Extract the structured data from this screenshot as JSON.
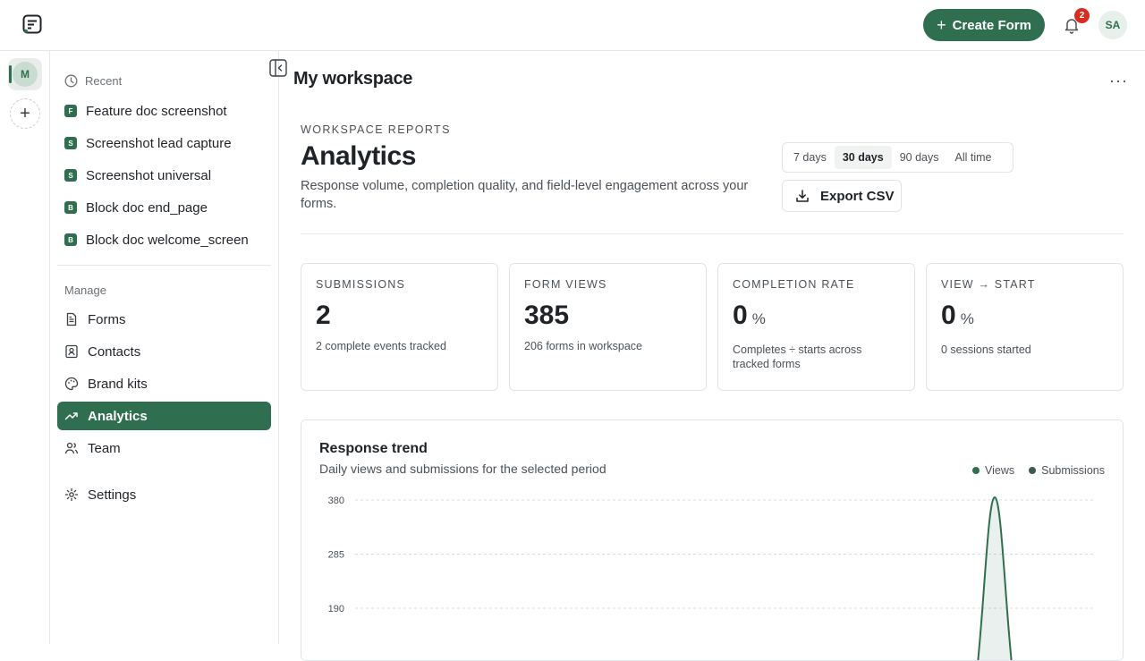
{
  "topbar": {
    "create_label": "Create Form",
    "notifications": "2",
    "user_initials": "SA"
  },
  "rail": {
    "workspace_initial": "M",
    "add": "+"
  },
  "sidebar": {
    "recent_label": "Recent",
    "recent": [
      {
        "badge": "F",
        "label": "Feature doc screenshot"
      },
      {
        "badge": "S",
        "label": "Screenshot lead capture"
      },
      {
        "badge": "S",
        "label": "Screenshot universal"
      },
      {
        "badge": "B",
        "label": "Block doc end_page"
      },
      {
        "badge": "B",
        "label": "Block doc welcome_screen"
      }
    ],
    "manage_label": "Manage",
    "manage": [
      {
        "icon": "file-icon",
        "label": "Forms"
      },
      {
        "icon": "contact-icon",
        "label": "Contacts"
      },
      {
        "icon": "palette-icon",
        "label": "Brand kits"
      },
      {
        "icon": "trend-icon",
        "label": "Analytics",
        "active": true
      },
      {
        "icon": "team-icon",
        "label": "Team"
      }
    ],
    "settings_label": "Settings"
  },
  "main": {
    "workspace_title": "My workspace",
    "more": "···",
    "eyebrow": "WORKSPACE REPORTS",
    "title": "Analytics",
    "description": "Response volume, completion quality, and field-level engagement across your forms.",
    "ranges": [
      "7 days",
      "30 days",
      "90 days",
      "All time"
    ],
    "selected_range": "30 days",
    "export_label": "Export CSV"
  },
  "cards": [
    {
      "label": "SUBMISSIONS",
      "value": "2",
      "unit": "",
      "sub": "2 complete events tracked"
    },
    {
      "label": "FORM VIEWS",
      "value": "385",
      "unit": "",
      "sub": "206 forms in workspace"
    },
    {
      "label": "COMPLETION RATE",
      "value": "0",
      "unit": "%",
      "sub": "Completes ÷ starts across tracked forms"
    },
    {
      "label": "VIEW → START",
      "value": "0",
      "unit": "%",
      "sub": "0 sessions started"
    }
  ],
  "trend": {
    "title": "Response trend",
    "subtitle": "Daily views and submissions for the selected period",
    "legend": [
      "Views",
      "Submissions"
    ]
  },
  "colors": {
    "accent": "#2f6f4f",
    "views": "#2f6f4f",
    "submissions": "#3f5a4d",
    "badge": "#d92d20"
  },
  "chart_data": {
    "type": "area",
    "series": [
      {
        "name": "Views",
        "peak_value": 380
      },
      {
        "name": "Submissions",
        "peak_value": 2
      }
    ],
    "y_ticks": [
      380,
      285,
      190
    ],
    "grid": true,
    "legend_placement": "top-right"
  }
}
